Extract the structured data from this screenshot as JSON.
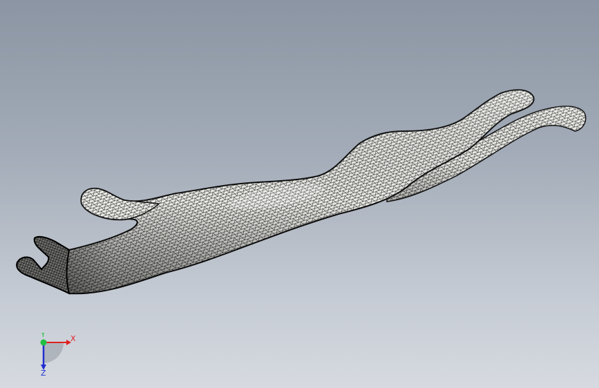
{
  "viewport": {
    "background_top": "#8b95a3",
    "background_bottom": "#d6dae0"
  },
  "model": {
    "display_mode": "mesh",
    "fill_color": "#e9e9e6",
    "edge_color": "#1a1a1a"
  },
  "triad": {
    "x_label": "X",
    "y_label": "Y",
    "z_label": "Z",
    "x_color": "#e02020",
    "y_color": "#20c040",
    "z_color": "#2030d0"
  }
}
